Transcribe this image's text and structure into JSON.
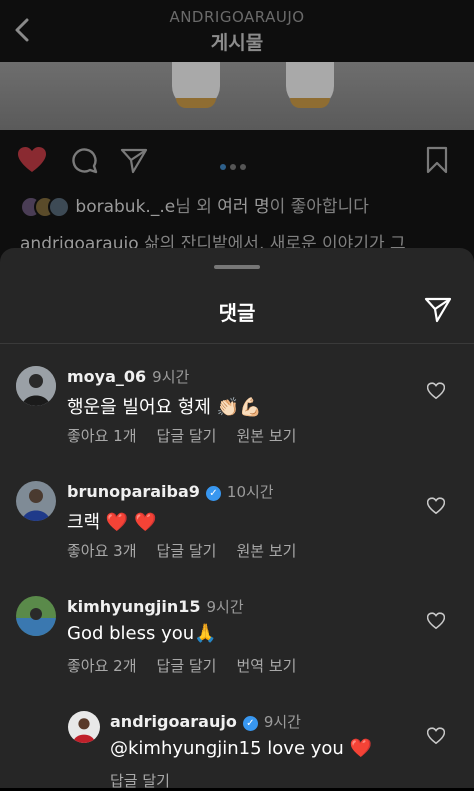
{
  "header": {
    "username": "ANDRIGOARAUJO",
    "title": "게시물"
  },
  "post": {
    "likes_user": "borabuk._.e",
    "likes_text": "님 외 ",
    "likes_bold": "여러 명",
    "likes_suffix": "이 좋아합니다",
    "caption_user": "andrigoaraujo",
    "caption_text": " 삶의 잔디밭에서, 새로운 이야기가 그"
  },
  "sheet": {
    "title": "댓글"
  },
  "comments": [
    {
      "username": "moya_06",
      "time": "9시간",
      "text": "행운을 빌어요 형제 👏🏻💪🏻",
      "likes": "좋아요 1개",
      "reply": "답글 달기",
      "translate": "원본 보기"
    },
    {
      "username": "brunoparaiba9",
      "time": "10시간",
      "text": "크랙 ❤️ ❤️",
      "likes": "좋아요 3개",
      "reply": "답글 달기",
      "translate": "원본 보기"
    },
    {
      "username": "kimhyungjin15",
      "time": "9시간",
      "text": "God bless you🙏",
      "likes": "좋아요 2개",
      "reply": "답글 달기",
      "translate": "번역 보기"
    },
    {
      "username": "andrigoaraujo",
      "time": "9시간",
      "text": "@kimhyungjin15 love you ❤️",
      "reply": "답글 달기"
    }
  ],
  "colors": {
    "heart_red": "#ed4956",
    "verified_blue": "#3897f0",
    "sheet_bg": "#262626"
  }
}
